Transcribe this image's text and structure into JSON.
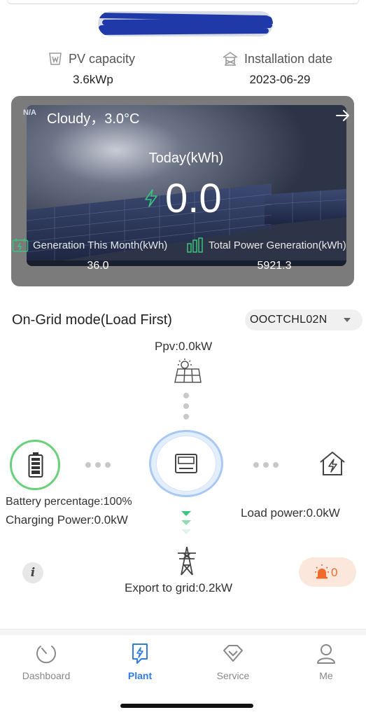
{
  "header": {
    "pv_capacity_label": "PV capacity",
    "pv_capacity_value": "3.6kWp",
    "install_date_label": "Installation date",
    "install_date_value": "2023-06-29"
  },
  "weather": {
    "aqi": "N/A",
    "condition": "Cloudy，3.0°C",
    "today_label": "Today(kWh)",
    "today_value": "0.0",
    "month_label": "Generation This Month(kWh)",
    "month_value": "36.0",
    "total_label": "Total Power Generation(kWh)",
    "total_value": "5921.3"
  },
  "mode": {
    "title": "On-Grid mode(Load First)",
    "device": "OOCTCHL02N"
  },
  "flow": {
    "ppv": "Ppv:0.0kW",
    "battery_percentage": "Battery percentage:100%",
    "charging_power": "Charging Power:0.0kW",
    "load_power": "Load power:0.0kW",
    "export_grid": "Export to grid:0.2kW",
    "alarm_count": "0"
  },
  "colors": {
    "accent": "#2f7de1",
    "battery_ring": "#6bd07a",
    "arrow_green": "#3ac47d",
    "alarm": "#f06a2a"
  },
  "tabs": [
    {
      "label": "Dashboard",
      "icon": "gauge-icon",
      "active": false
    },
    {
      "label": "Plant",
      "icon": "plant-icon",
      "active": true
    },
    {
      "label": "Service",
      "icon": "diamond-icon",
      "active": false
    },
    {
      "label": "Me",
      "icon": "person-icon",
      "active": false
    }
  ]
}
